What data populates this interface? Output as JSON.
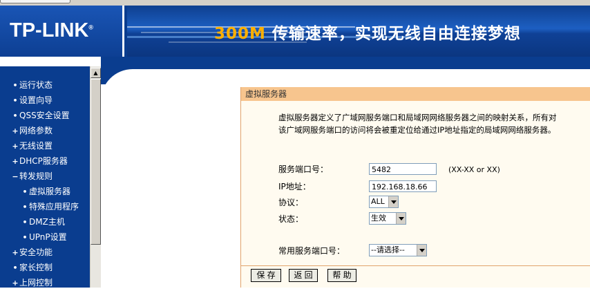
{
  "header": {
    "logo": "TP-LINK",
    "logo_reg": "®",
    "banner_highlight": "300M",
    "banner_text": "传输速率，实现无线自由连接梦想"
  },
  "sidebar": {
    "items": [
      {
        "marker": "•",
        "label": "运行状态"
      },
      {
        "marker": "•",
        "label": "设置向导"
      },
      {
        "marker": "•",
        "label": "QSS安全设置"
      },
      {
        "marker": "+",
        "label": "网络参数"
      },
      {
        "marker": "+",
        "label": "无线设置"
      },
      {
        "marker": "+",
        "label": "DHCP服务器"
      },
      {
        "marker": "−",
        "label": "转发规则"
      },
      {
        "marker": "•",
        "label": "虚拟服务器"
      },
      {
        "marker": "•",
        "label": "特殊应用程序"
      },
      {
        "marker": "•",
        "label": "DMZ主机"
      },
      {
        "marker": "•",
        "label": "UPnP设置"
      },
      {
        "marker": "+",
        "label": "安全功能"
      },
      {
        "marker": "•",
        "label": "家长控制"
      },
      {
        "marker": "+",
        "label": "上网控制"
      }
    ]
  },
  "panel": {
    "title": "虚拟服务器",
    "description": "虚拟服务器定义了广域网服务端口和局域网网络服务器之间的映射关系，所有对该广域网服务端口的访问将会被重定位给通过IP地址指定的局域网网络服务器。",
    "port_label": "服务端口号：",
    "port_value": "5482",
    "port_hint": "(XX-XX or XX)",
    "ip_label": "IP地址：",
    "ip_value": "192.168.18.66",
    "protocol_label": "协议：",
    "protocol_value": "ALL",
    "status_label": "状态：",
    "status_value": "生效",
    "common_port_label": "常用服务端口号：",
    "common_port_value": "--请选择--"
  },
  "buttons": {
    "save": "保 存",
    "back": "返 回",
    "help": "帮 助"
  },
  "colors": {
    "brand_blue": "#0a3d8f",
    "panel_title_bg": "#f7c58e",
    "panel_bg": "#fffbf0",
    "banner_highlight": "#ffb000"
  }
}
